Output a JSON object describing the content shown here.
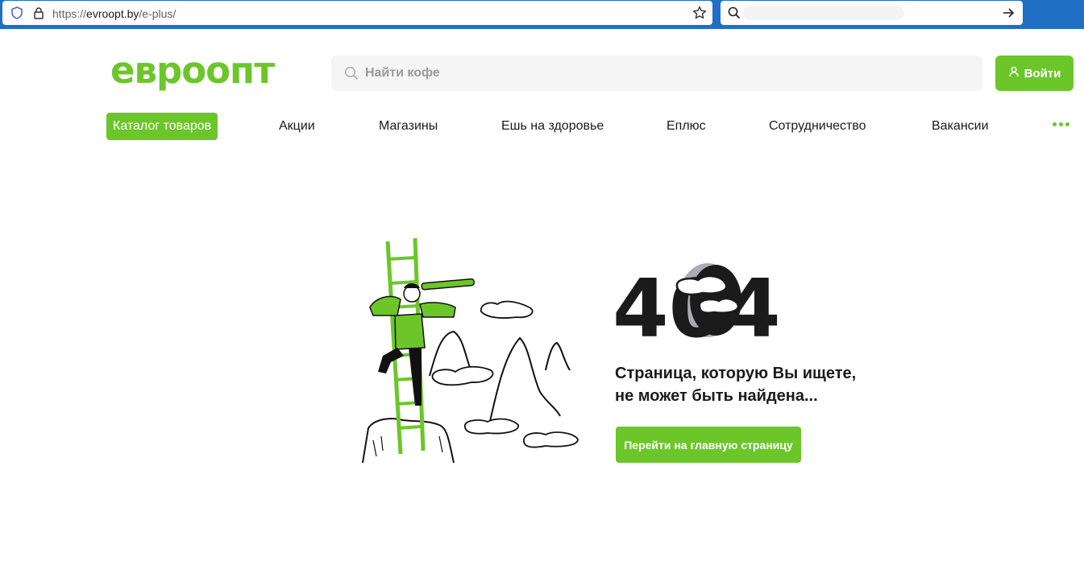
{
  "browser": {
    "url_host": "evroopt.by",
    "url_path": "/e-plus/",
    "url_scheme": "https://",
    "icons": [
      "shield-icon",
      "lock-icon",
      "star-icon",
      "search-icon",
      "arrow-right-icon"
    ]
  },
  "header": {
    "logo_text": "евроопт",
    "search_placeholder": "Найти кофе",
    "login_label": "Войти"
  },
  "nav": {
    "items": [
      {
        "label": "Каталог товаров"
      },
      {
        "label": "Акции"
      },
      {
        "label": "Магазины"
      },
      {
        "label": "Ешь на здоровье"
      },
      {
        "label": "Еплюс"
      },
      {
        "label": "Сотрудничество"
      },
      {
        "label": "Вакансии"
      }
    ]
  },
  "error": {
    "code": "404",
    "message_line1": "Страница, которую Вы ищете,",
    "message_line2": "не может быть найдена...",
    "home_button_label": "Перейти на главную страницу"
  },
  "colors": {
    "brand_green": "#6cc62a",
    "browser_blue": "#1f6fc5",
    "text_dark": "#1b1b1b"
  }
}
